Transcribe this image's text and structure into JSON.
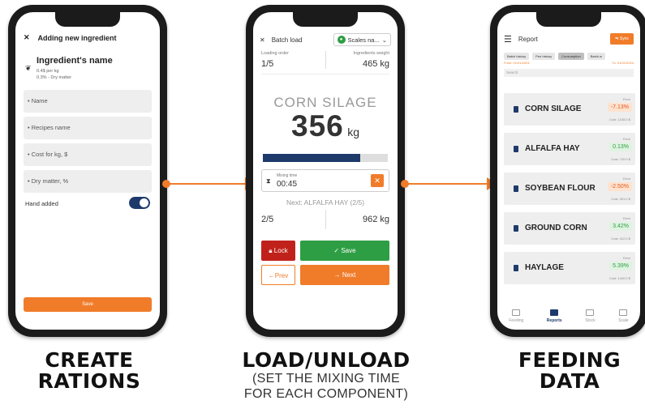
{
  "phone1": {
    "header_title": "Adding new ingredient",
    "ingredient_name": "Ingredient's name",
    "price_line": "0.4$ per kg",
    "dm_line": "0.3% - Dry matter",
    "fields": [
      "• Name",
      "• Recipes name",
      "• Cost for kg, $",
      "• Dry matter, %"
    ],
    "hand_added_label": "Hand added",
    "save_label": "Save"
  },
  "phone2": {
    "header_title": "Batch load",
    "scales_label": "Scales na...",
    "loading_order_label": "Loading order",
    "loading_order_value": "1/5",
    "ingredients_weight_label": "Ingredients weight",
    "ingredients_weight_value": "465 kg",
    "ingredient": "CORN SILAGE",
    "weight_value": "356",
    "weight_unit": "kg",
    "progress": 0.78,
    "mixing_label": "Mixing time",
    "mixing_time": "00:45",
    "next_text": "Next: ALFALFA HAY (2/5)",
    "next_order": "2/5",
    "next_weight": "962 kg",
    "lock_label": "Lock",
    "save_label": "Save",
    "prev_label": "Prev",
    "next_label": "Next"
  },
  "phone3": {
    "header_title": "Report",
    "sync_label": "Sync",
    "tabs": [
      "Batch history",
      "Pen history",
      "Consumption",
      "Batch w"
    ],
    "from_label": "From: 01/01/2024",
    "to_label": "To: 01/01/2024",
    "search_placeholder": "Search",
    "error_label": "Error",
    "items": [
      {
        "name": "CORN SILAGE",
        "pct": "-7.13%",
        "cost": "Cost: 1245.0 $",
        "sign": "neg"
      },
      {
        "name": "ALFALFA HAY",
        "pct": "0.13%",
        "cost": "Cost: 720.0 $",
        "sign": "pos"
      },
      {
        "name": "SOYBEAN FLOUR",
        "pct": "-2.50%",
        "cost": "Cost: 301.0 $",
        "sign": "neg"
      },
      {
        "name": "GROUND CORN",
        "pct": "3.42%",
        "cost": "Cost: 412.0 $",
        "sign": "pos"
      },
      {
        "name": "HAYLAGE",
        "pct": "5.39%",
        "cost": "Cost: 1442.0 $",
        "sign": "pos"
      }
    ],
    "nav": [
      "Feeding",
      "Reports",
      "Stock",
      "Scale"
    ]
  },
  "captions": {
    "c1_line1": "CREATE",
    "c1_line2": "RATIONS",
    "c2_title": "LOAD/UNLOAD",
    "c2_sub1": "(SET THE MIXING TIME",
    "c2_sub2": "FOR EACH COMPONENT)",
    "c3_line1": "FEEDING",
    "c3_line2": "DATA"
  },
  "colors": {
    "accent": "#f07c2a",
    "navy": "#1e3a6b",
    "green": "#2e9e44",
    "red": "#c0221b"
  }
}
